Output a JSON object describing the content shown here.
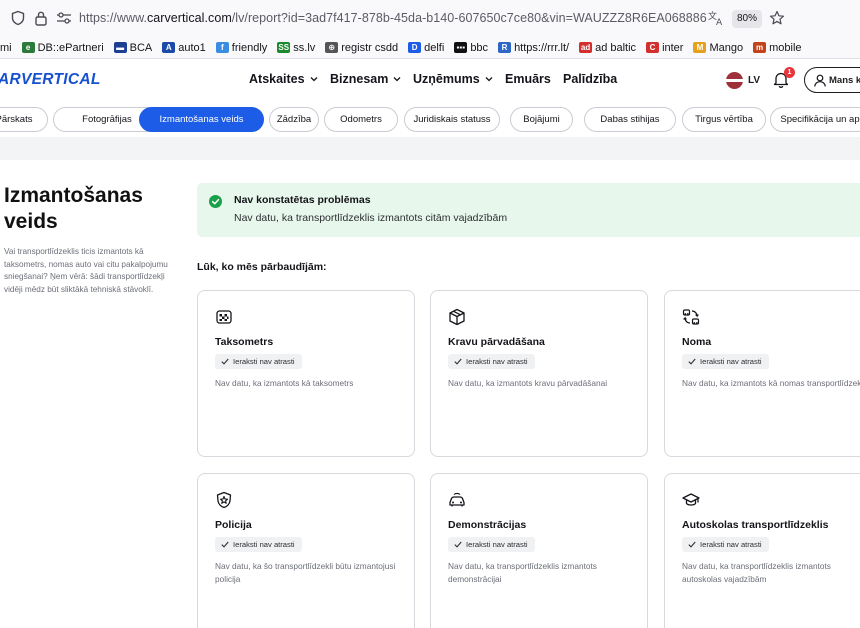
{
  "browser": {
    "url_scheme": "https://www.",
    "url_host": "carvertical.com",
    "url_path": "/lv/report?id=3ad7f417-878b-45da-b140-607650c7ce80&vin=WAUZZZ8R6EA068886",
    "zoom": "80%"
  },
  "bookmarks": [
    {
      "label": "mi",
      "color": "#888888",
      "glyph": ""
    },
    {
      "label": "DB::ePartneri",
      "color": "#2b7a3b",
      "glyph": "e"
    },
    {
      "label": "BCA",
      "color": "#1c3f94",
      "glyph": "▬"
    },
    {
      "label": "auto1",
      "color": "#1b4aa8",
      "glyph": "A"
    },
    {
      "label": "friendly",
      "color": "#3b8de0",
      "glyph": "f"
    },
    {
      "label": "ss.lv",
      "color": "#1a8a2c",
      "glyph": "SS"
    },
    {
      "label": "registr csdd",
      "color": "#555555",
      "glyph": "⊕"
    },
    {
      "label": "delfi",
      "color": "#1d5ce6",
      "glyph": "D"
    },
    {
      "label": "bbc",
      "color": "#111111",
      "glyph": "▪▪▪"
    },
    {
      "label": "https://rrr.lt/",
      "color": "#2d66c4",
      "glyph": "R"
    },
    {
      "label": "ad baltic",
      "color": "#d32f2f",
      "glyph": "ad"
    },
    {
      "label": "inter",
      "color": "#d32f2f",
      "glyph": "C"
    },
    {
      "label": "Mango",
      "color": "#e6a11c",
      "glyph": "M"
    },
    {
      "label": "mobile",
      "color": "#c2431a",
      "glyph": "m"
    }
  ],
  "site": {
    "logo": "ARVERTICAL",
    "nav": [
      {
        "label": "Atskaites",
        "has_dropdown": true
      },
      {
        "label": "Biznesam",
        "has_dropdown": true
      },
      {
        "label": "Uzņēmums",
        "has_dropdown": true
      },
      {
        "label": "Emuārs",
        "has_dropdown": false
      },
      {
        "label": "Palīdzība",
        "has_dropdown": false
      }
    ],
    "language": "LV",
    "notification_count": "1",
    "account_button": "Mans k"
  },
  "tabs": [
    {
      "label": "Pārskats",
      "active": false
    },
    {
      "label": "Fotogrāfijas",
      "active": false
    },
    {
      "label": "Izmantošanas veids",
      "active": true
    },
    {
      "label": "Zādzība",
      "active": false
    },
    {
      "label": "Odometrs",
      "active": false
    },
    {
      "label": "Juridiskais statuss",
      "active": false
    },
    {
      "label": "Bojājumi",
      "active": false
    },
    {
      "label": "Dabas stihijas",
      "active": false
    },
    {
      "label": "Tirgus vērtība",
      "active": false
    },
    {
      "label": "Specifikācija un ap",
      "active": false
    }
  ],
  "section": {
    "title": "Izmantošanas veids",
    "description": "Vai transportlīdzeklis ticis izmantots kā taksometrs, nomas auto vai citu pakalpojumu sniegšanai? Ņem vērā: šādi transportlīdzekļi vidēji mēdz būt sliktākā tehniskā stāvoklī."
  },
  "status": {
    "title": "Nav konstatētas problēmas",
    "text": "Nav datu, ka transportlīdzeklis izmantots citām vajadzībām",
    "color": "#1aa04a"
  },
  "checked_title": "Lūk, ko mēs pārbaudījām:",
  "cards": [
    {
      "icon": "taxi-icon",
      "title": "Taksometrs",
      "badge": "Ieraksti nav atrasti",
      "desc": "Nav datu, ka izmantots kā taksometrs"
    },
    {
      "icon": "box-icon",
      "title": "Kravu pārvadāšana",
      "badge": "Ieraksti nav atrasti",
      "desc": "Nav datu, ka izmantots kravu pārvadāšanai"
    },
    {
      "icon": "rental-icon",
      "title": "Noma",
      "badge": "Ieraksti nav atrasti",
      "desc": "Nav datu, ka izmantots kā nomas transportlīdzeklis"
    },
    {
      "icon": "police-badge-icon",
      "title": "Policija",
      "badge": "Ieraksti nav atrasti",
      "desc": "Nav datu, ka šo transportlīdzekli būtu izmantojusi policija"
    },
    {
      "icon": "demo-car-icon",
      "title": "Demonstrācijas",
      "badge": "Ieraksti nav atrasti",
      "desc": "Nav datu, ka transportlīdzeklis izmantots demonstrācijai"
    },
    {
      "icon": "graduation-cap-icon",
      "title": "Autoskolas transportlīdzeklis",
      "badge": "Ieraksti nav atrasti",
      "desc": "Nav datu, ka transportlīdzeklis izmantots autoskolas vajadzībām"
    }
  ]
}
